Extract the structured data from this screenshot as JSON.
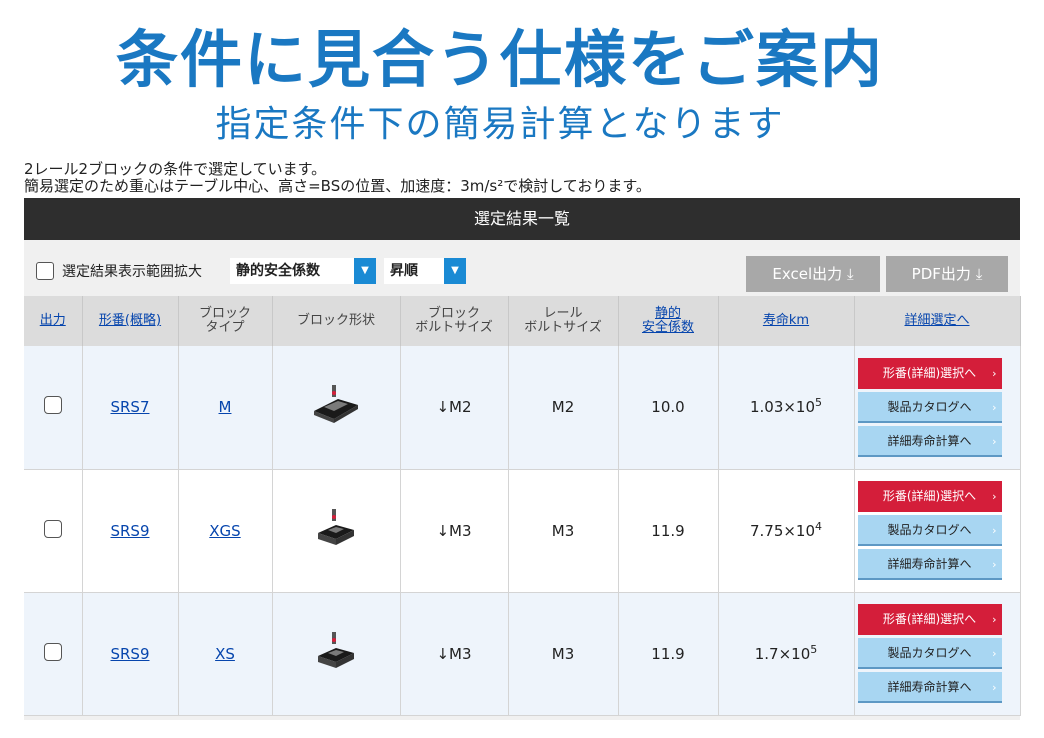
{
  "hero": {
    "title": "条件に見合う仕様をご案内",
    "subtitle": "指定条件下の簡易計算となります"
  },
  "notes": [
    "2レール2ブロックの条件で選定しています。",
    "簡易選定のため重心はテーブル中心、高さ=BSの位置、加速度：3m/s²で検討しております。"
  ],
  "panel": {
    "header": "選定結果一覧",
    "expand_label": "選定結果表示範囲拡大",
    "sort_select": "静的安全係数",
    "order_select": "昇順",
    "excel_button": "Excel出力",
    "pdf_button": "PDF出力"
  },
  "columns": {
    "output": "出力",
    "model": "形番(概略)",
    "block_type_1": "ブロック",
    "block_type_2": "タイプ",
    "block_shape": "ブロック形状",
    "block_bolt_1": "ブロック",
    "block_bolt_2": "ボルトサイズ",
    "rail_bolt_1": "レール",
    "rail_bolt_2": "ボルトサイズ",
    "safety_1": "静的",
    "safety_2": "安全係数",
    "life": "寿命km",
    "detail": "詳細選定へ"
  },
  "actions": {
    "detail_select": "形番(詳細)選択へ",
    "catalog": "製品カタログへ",
    "life_calc": "詳細寿命計算へ"
  },
  "rows": [
    {
      "model": "SRS7",
      "type": "M",
      "block_bolt": "↓M2",
      "rail_bolt": "M2",
      "safety": "10.0",
      "life_base": "1.03×10",
      "life_exp": "5"
    },
    {
      "model": "SRS9",
      "type": "XGS",
      "block_bolt": "↓M3",
      "rail_bolt": "M3",
      "safety": "11.9",
      "life_base": "7.75×10",
      "life_exp": "4"
    },
    {
      "model": "SRS9",
      "type": "XS",
      "block_bolt": "↓M3",
      "rail_bolt": "M3",
      "safety": "11.9",
      "life_base": "1.7×10",
      "life_exp": "5"
    }
  ],
  "colors": {
    "accent": "#1a78c2",
    "header_bg": "#2e2e2e",
    "red": "#d41e3a",
    "light_blue": "#a8d6f2"
  }
}
